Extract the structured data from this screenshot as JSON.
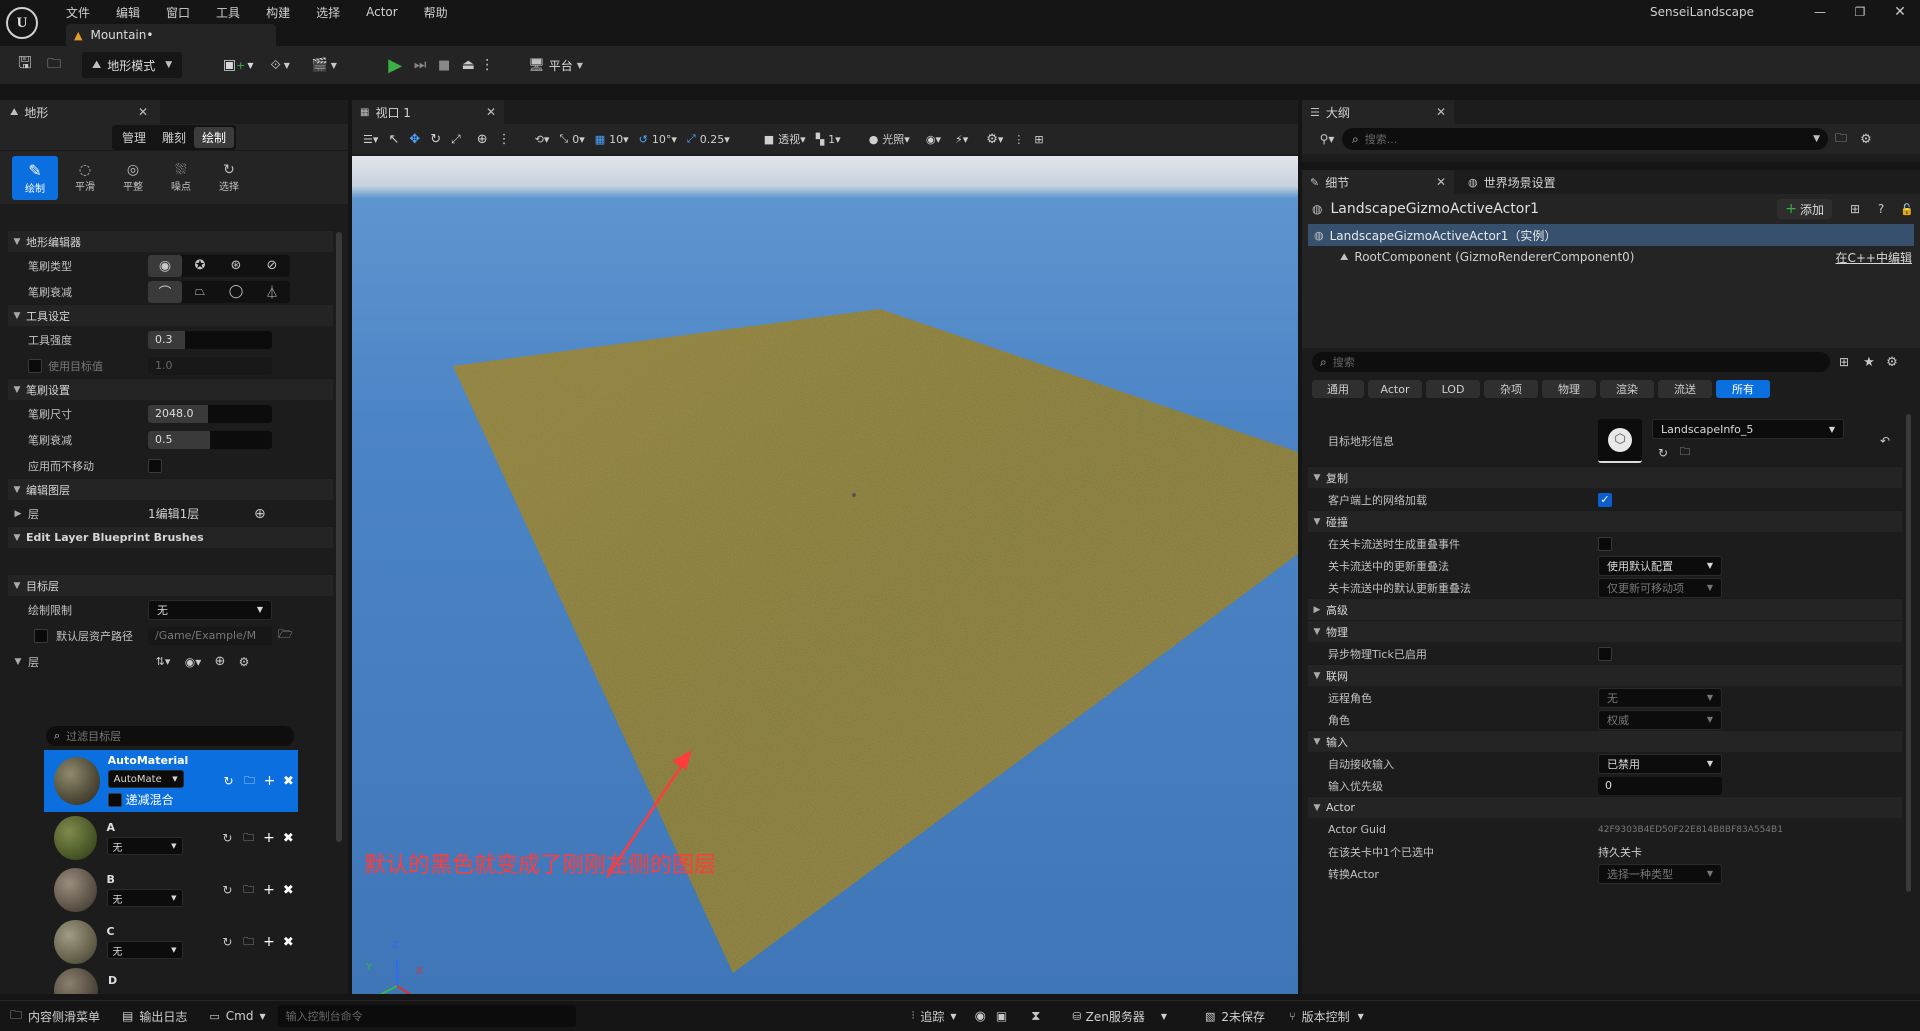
{
  "menu": [
    "文件",
    "编辑",
    "窗口",
    "工具",
    "构建",
    "选择",
    "Actor",
    "帮助"
  ],
  "project_name": "SenseiLandscape",
  "level_tab": "Mountain•",
  "main_toolbar": {
    "mode_label": "地形模式",
    "platform_label": "平台"
  },
  "landscape_panel": {
    "title": "地形",
    "subtabs": [
      "管理",
      "雕刻",
      "绘制"
    ],
    "active_subtab": "绘制",
    "tools": [
      {
        "label": "绘制",
        "active": true
      },
      {
        "label": "平滑",
        "active": false
      },
      {
        "label": "平整",
        "active": false
      },
      {
        "label": "噪点",
        "active": false
      },
      {
        "label": "选择",
        "active": false
      }
    ],
    "sections": {
      "editor": "地形编辑器",
      "tool_settings": "工具设定",
      "brush_settings": "笔刷设置",
      "edit_layers": "编辑图层",
      "blueprint_brushes": "Edit Layer Blueprint Brushes",
      "target_layers": "目标层"
    },
    "props": {
      "brush_type": "笔刷类型",
      "brush_falloff_type": "笔刷衰减",
      "tool_strength": "工具强度",
      "tool_strength_value": "0.3",
      "use_target": "使用目标值",
      "use_target_value": "1.0",
      "brush_size": "笔刷尺寸",
      "brush_size_value": "2048.0",
      "brush_falloff": "笔刷衰减",
      "brush_falloff_value": "0.5",
      "apply_no_move": "应用而不移动",
      "layer": "层",
      "layer_value": "1编辑1层",
      "paint_restriction": "绘制限制",
      "paint_restriction_value": "无",
      "default_layer_path": "默认层资产路径",
      "default_layer_path_value": "/Game/Example/M",
      "layers_label": "层",
      "filter_placeholder": "过滤目标层"
    },
    "target_layers": [
      {
        "name": "AutoMaterial",
        "combo": "AutoMate",
        "selected": true,
        "blend_label": "递减混合"
      },
      {
        "name": "A",
        "combo": "无",
        "selected": false
      },
      {
        "name": "B",
        "combo": "无",
        "selected": false
      },
      {
        "name": "C",
        "combo": "无",
        "selected": false
      },
      {
        "name": "D",
        "combo": "",
        "selected": false
      }
    ]
  },
  "viewport": {
    "tab": "视口 1",
    "toolbar": {
      "rot_snap": "0",
      "grid_snap": "10",
      "angle_snap": "10°",
      "scale_snap": "0.25",
      "view_mode": "透视",
      "camera_speed": "1",
      "lighting": "光照"
    },
    "annotation": "默认的黑色就变成了刚刚左侧的图层",
    "axis": {
      "x": "X",
      "y": "Y",
      "z": "Z"
    }
  },
  "outliner": {
    "title": "大纲",
    "search_placeholder": "搜索..."
  },
  "details": {
    "tab": "细节",
    "tab2": "世界场景设置",
    "actor_name": "LandscapeGizmoActiveActor1",
    "add_label": "添加",
    "instance_row": "LandscapeGizmoActiveActor1（实例）",
    "root_component": "RootComponent (GizmoRendererComponent0)",
    "edit_cpp": "在C++中编辑",
    "search_placeholder": "搜索",
    "categories": [
      "通用",
      "Actor",
      "LOD",
      "杂项",
      "物理",
      "渲染",
      "流送",
      "所有"
    ],
    "active_category": "所有",
    "target_landscape_label": "目标地形信息",
    "target_landscape_value": "LandscapeInfo_5",
    "rows": [
      {
        "type": "section",
        "label": "复制"
      },
      {
        "type": "check",
        "label": "客户端上的网络加载",
        "checked": true
      },
      {
        "type": "section",
        "label": "碰撞"
      },
      {
        "type": "check",
        "label": "在关卡流送时生成重叠事件",
        "checked": false
      },
      {
        "type": "combo",
        "label": "关卡流送中的更新重叠法",
        "value": "使用默认配置",
        "dim": false
      },
      {
        "type": "combo",
        "label": "关卡流送中的默认更新重叠法",
        "value": "仅更新可移动项",
        "dim": true
      },
      {
        "type": "section",
        "label": "高级",
        "collapsed": true
      },
      {
        "type": "section",
        "label": "物理"
      },
      {
        "type": "check",
        "label": "异步物理Tick已启用",
        "checked": false
      },
      {
        "type": "section",
        "label": "联网"
      },
      {
        "type": "combo",
        "label": "远程角色",
        "value": "无",
        "dim": true
      },
      {
        "type": "combo",
        "label": "角色",
        "value": "权威",
        "dim": true
      },
      {
        "type": "section",
        "label": "输入"
      },
      {
        "type": "combo",
        "label": "自动接收输入",
        "value": "已禁用",
        "dim": false
      },
      {
        "type": "number",
        "label": "输入优先级",
        "value": "0"
      },
      {
        "type": "section",
        "label": "Actor"
      },
      {
        "type": "text",
        "label": "Actor Guid",
        "value": "42F9303B4ED50F22E814B8BF83A554B1",
        "dim": true
      },
      {
        "type": "text",
        "label": "在该关卡中1个已选中",
        "value": "持久关卡",
        "dim": false
      },
      {
        "type": "combo",
        "label": "转换Actor",
        "value": "选择一种类型",
        "dim": true
      }
    ]
  },
  "statusbar": {
    "content_drawer": "内容侧滑菜单",
    "output_log": "输出日志",
    "cmd": "Cmd",
    "console_placeholder": "输入控制台命令",
    "trace": "追踪",
    "zen": "Zen服务器",
    "unsaved": "2未保存",
    "source_control": "版本控制"
  },
  "colors": {
    "accent": "#0b6fe0",
    "play": "#3cb043",
    "annotation": "#ff3b3b",
    "sky": "#4c85c6"
  }
}
